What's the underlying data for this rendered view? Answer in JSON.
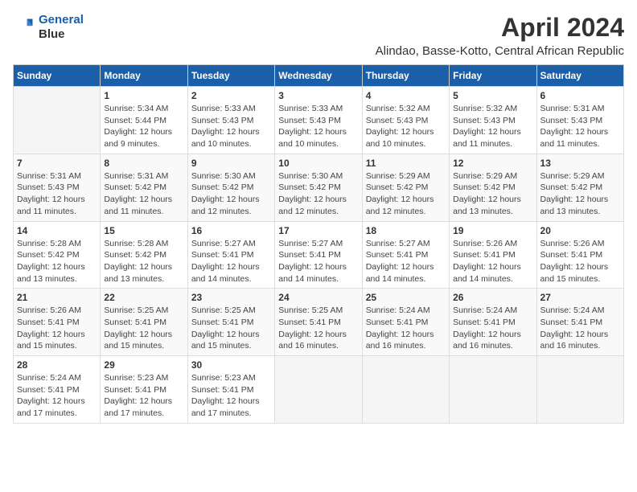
{
  "logo": {
    "line1": "General",
    "line2": "Blue"
  },
  "title": "April 2024",
  "subtitle": "Alindao, Basse-Kotto, Central African Republic",
  "days_header": [
    "Sunday",
    "Monday",
    "Tuesday",
    "Wednesday",
    "Thursday",
    "Friday",
    "Saturday"
  ],
  "weeks": [
    [
      {
        "day": "",
        "info": ""
      },
      {
        "day": "1",
        "info": "Sunrise: 5:34 AM\nSunset: 5:44 PM\nDaylight: 12 hours\nand 9 minutes."
      },
      {
        "day": "2",
        "info": "Sunrise: 5:33 AM\nSunset: 5:43 PM\nDaylight: 12 hours\nand 10 minutes."
      },
      {
        "day": "3",
        "info": "Sunrise: 5:33 AM\nSunset: 5:43 PM\nDaylight: 12 hours\nand 10 minutes."
      },
      {
        "day": "4",
        "info": "Sunrise: 5:32 AM\nSunset: 5:43 PM\nDaylight: 12 hours\nand 10 minutes."
      },
      {
        "day": "5",
        "info": "Sunrise: 5:32 AM\nSunset: 5:43 PM\nDaylight: 12 hours\nand 11 minutes."
      },
      {
        "day": "6",
        "info": "Sunrise: 5:31 AM\nSunset: 5:43 PM\nDaylight: 12 hours\nand 11 minutes."
      }
    ],
    [
      {
        "day": "7",
        "info": "Sunrise: 5:31 AM\nSunset: 5:43 PM\nDaylight: 12 hours\nand 11 minutes."
      },
      {
        "day": "8",
        "info": "Sunrise: 5:31 AM\nSunset: 5:42 PM\nDaylight: 12 hours\nand 11 minutes."
      },
      {
        "day": "9",
        "info": "Sunrise: 5:30 AM\nSunset: 5:42 PM\nDaylight: 12 hours\nand 12 minutes."
      },
      {
        "day": "10",
        "info": "Sunrise: 5:30 AM\nSunset: 5:42 PM\nDaylight: 12 hours\nand 12 minutes."
      },
      {
        "day": "11",
        "info": "Sunrise: 5:29 AM\nSunset: 5:42 PM\nDaylight: 12 hours\nand 12 minutes."
      },
      {
        "day": "12",
        "info": "Sunrise: 5:29 AM\nSunset: 5:42 PM\nDaylight: 12 hours\nand 13 minutes."
      },
      {
        "day": "13",
        "info": "Sunrise: 5:29 AM\nSunset: 5:42 PM\nDaylight: 12 hours\nand 13 minutes."
      }
    ],
    [
      {
        "day": "14",
        "info": "Sunrise: 5:28 AM\nSunset: 5:42 PM\nDaylight: 12 hours\nand 13 minutes."
      },
      {
        "day": "15",
        "info": "Sunrise: 5:28 AM\nSunset: 5:42 PM\nDaylight: 12 hours\nand 13 minutes."
      },
      {
        "day": "16",
        "info": "Sunrise: 5:27 AM\nSunset: 5:41 PM\nDaylight: 12 hours\nand 14 minutes."
      },
      {
        "day": "17",
        "info": "Sunrise: 5:27 AM\nSunset: 5:41 PM\nDaylight: 12 hours\nand 14 minutes."
      },
      {
        "day": "18",
        "info": "Sunrise: 5:27 AM\nSunset: 5:41 PM\nDaylight: 12 hours\nand 14 minutes."
      },
      {
        "day": "19",
        "info": "Sunrise: 5:26 AM\nSunset: 5:41 PM\nDaylight: 12 hours\nand 14 minutes."
      },
      {
        "day": "20",
        "info": "Sunrise: 5:26 AM\nSunset: 5:41 PM\nDaylight: 12 hours\nand 15 minutes."
      }
    ],
    [
      {
        "day": "21",
        "info": "Sunrise: 5:26 AM\nSunset: 5:41 PM\nDaylight: 12 hours\nand 15 minutes."
      },
      {
        "day": "22",
        "info": "Sunrise: 5:25 AM\nSunset: 5:41 PM\nDaylight: 12 hours\nand 15 minutes."
      },
      {
        "day": "23",
        "info": "Sunrise: 5:25 AM\nSunset: 5:41 PM\nDaylight: 12 hours\nand 15 minutes."
      },
      {
        "day": "24",
        "info": "Sunrise: 5:25 AM\nSunset: 5:41 PM\nDaylight: 12 hours\nand 16 minutes."
      },
      {
        "day": "25",
        "info": "Sunrise: 5:24 AM\nSunset: 5:41 PM\nDaylight: 12 hours\nand 16 minutes."
      },
      {
        "day": "26",
        "info": "Sunrise: 5:24 AM\nSunset: 5:41 PM\nDaylight: 12 hours\nand 16 minutes."
      },
      {
        "day": "27",
        "info": "Sunrise: 5:24 AM\nSunset: 5:41 PM\nDaylight: 12 hours\nand 16 minutes."
      }
    ],
    [
      {
        "day": "28",
        "info": "Sunrise: 5:24 AM\nSunset: 5:41 PM\nDaylight: 12 hours\nand 17 minutes."
      },
      {
        "day": "29",
        "info": "Sunrise: 5:23 AM\nSunset: 5:41 PM\nDaylight: 12 hours\nand 17 minutes."
      },
      {
        "day": "30",
        "info": "Sunrise: 5:23 AM\nSunset: 5:41 PM\nDaylight: 12 hours\nand 17 minutes."
      },
      {
        "day": "",
        "info": ""
      },
      {
        "day": "",
        "info": ""
      },
      {
        "day": "",
        "info": ""
      },
      {
        "day": "",
        "info": ""
      }
    ]
  ]
}
